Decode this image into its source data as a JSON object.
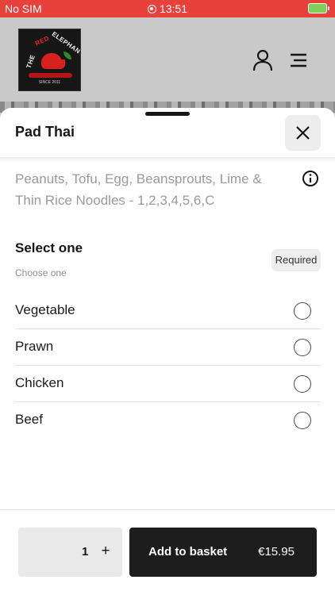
{
  "status_bar": {
    "carrier": "No SIM",
    "time": "13:51"
  },
  "header": {
    "logo": {
      "line1": "THE",
      "line2": "RED",
      "line3": "ELEPHANT",
      "since": "SINCE 2011"
    },
    "icons": [
      "user-icon",
      "menu-icon"
    ]
  },
  "sheet": {
    "title": "Pad Thai",
    "description": "Peanuts, Tofu, Egg, Beansprouts, Lime & Thin Rice Noodles - 1,2,3,4,5,6,C",
    "section": {
      "title": "Select one",
      "subtitle": "Choose one",
      "badge": "Required"
    },
    "options": [
      {
        "label": "Vegetable"
      },
      {
        "label": "Prawn"
      },
      {
        "label": "Chicken"
      },
      {
        "label": "Beef"
      }
    ]
  },
  "footer": {
    "quantity": "1",
    "plus": "+",
    "add_label": "Add to basket",
    "price": "€15.95"
  },
  "colors": {
    "status_bar": "#e8403b",
    "button": "#1d1d1d",
    "brand_red": "#d8201f"
  }
}
